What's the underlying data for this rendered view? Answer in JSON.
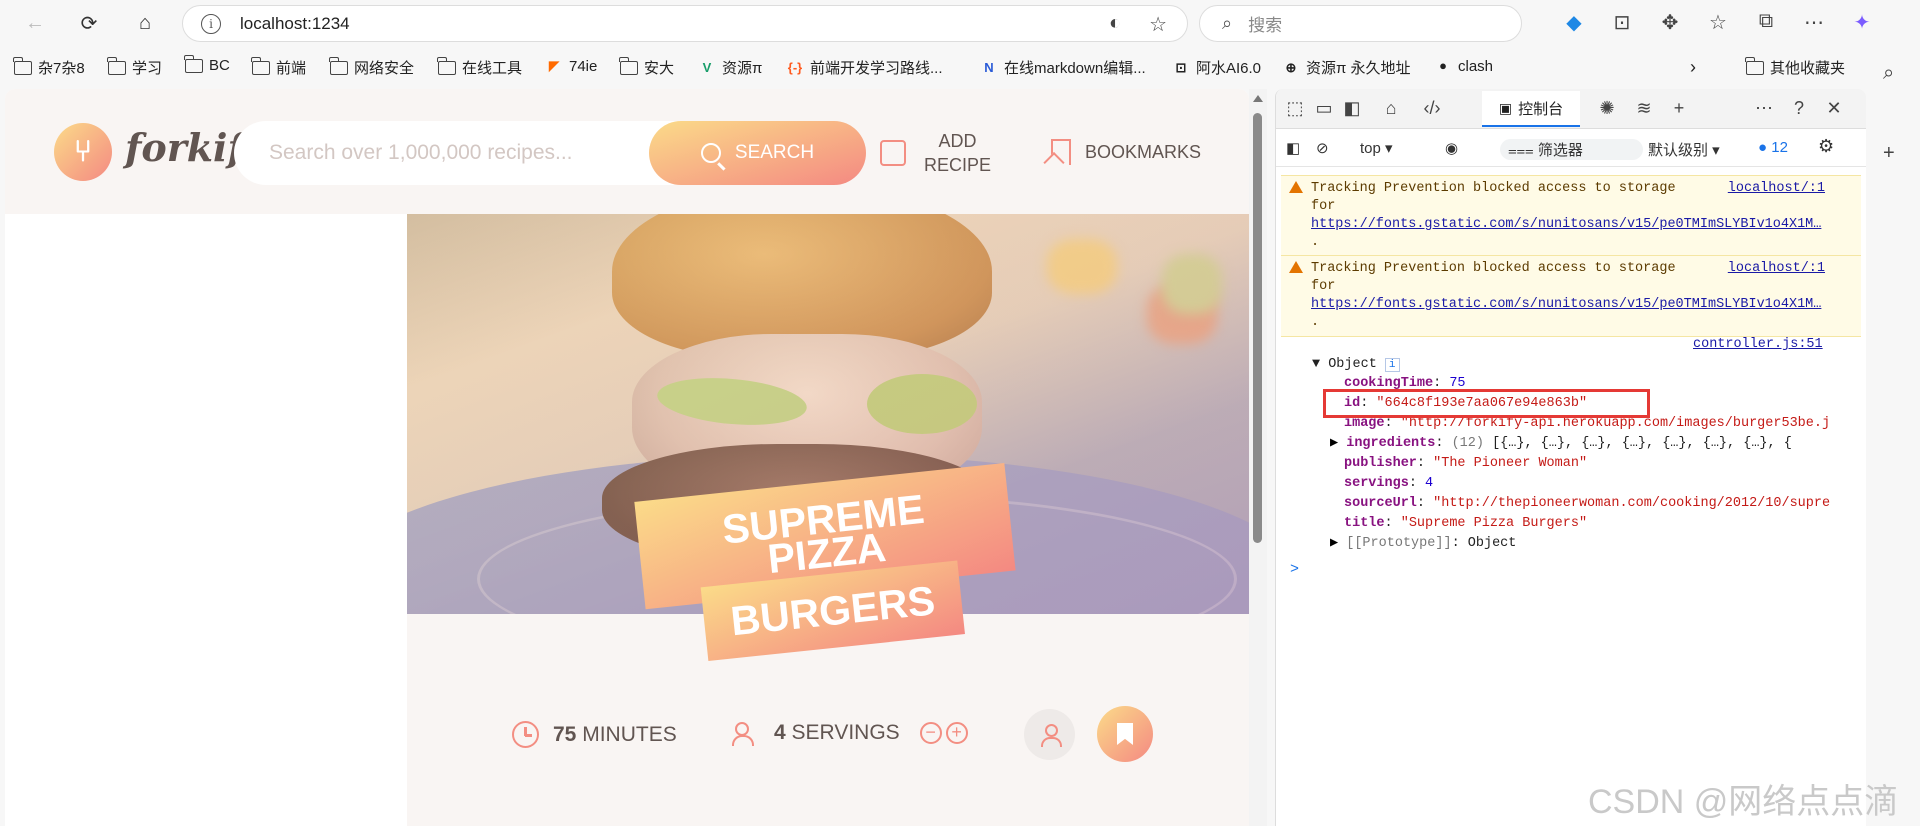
{
  "browser": {
    "url": "localhost:1234",
    "search_placeholder": "搜索",
    "bookmarks": [
      "杂7杂8",
      "学习",
      "BC",
      "前端",
      "网络安全",
      "在线工具",
      "74ie",
      "安大",
      "资源π",
      "前端开发学习路线...",
      "在线markdown编辑...",
      "阿水AI6.0",
      "资源π 永久地址",
      "clash",
      "其他收藏夹"
    ]
  },
  "app": {
    "logo": "forkify",
    "search_placeholder": "Search over 1,000,000 recipes...",
    "search_button": "SEARCH",
    "add_recipe_line1": "ADD",
    "add_recipe_line2": "RECIPE",
    "bookmarks_label": "BOOKMARKS",
    "recipe": {
      "title_line1": "SUPREME PIZZA",
      "title_line2": "BURGERS",
      "minutes_value": "75",
      "minutes_label": "MINUTES",
      "servings_value": "4",
      "servings_label": "SERVINGS"
    }
  },
  "devtools": {
    "console_tab": "控制台",
    "context": "top",
    "filter": "筛选器",
    "level": "默认级别",
    "issue_count": "12",
    "messages": [
      {
        "text": "Tracking Prevention blocked access to storage",
        "for": "for",
        "link": "https://fonts.gstatic.com/s/nunitosans/v15/pe0TMImSLYBIv1o4X1M…",
        "dot": ".",
        "source": "localhost/:1"
      },
      {
        "text": "Tracking Prevention blocked access to storage",
        "for": "for",
        "link": "https://fonts.gstatic.com/s/nunitosans/v15/pe0TMImSLYBIv1o4X1M…",
        "dot": ".",
        "source": "localhost/:1"
      }
    ],
    "log_source": "controller.js:51",
    "object_label": "Object",
    "object_badge": "i",
    "props": {
      "cookingTime_key": "cookingTime",
      "cookingTime_val": "75",
      "id_key": "id",
      "id_val": "\"664c8f193e7aa067e94e863b\"",
      "image_key": "image",
      "image_val": "\"http://forkify-api.herokuapp.com/images/burger53be.j",
      "ingredients_key": "ingredients",
      "ingredients_count": "(12)",
      "ingredients_val": "[{…}, {…}, {…}, {…}, {…}, {…}, {…}, {",
      "publisher_key": "publisher",
      "publisher_val": "\"The Pioneer Woman\"",
      "servings_key": "servings",
      "servings_val": "4",
      "sourceUrl_key": "sourceUrl",
      "sourceUrl_val": "\"http://thepioneerwoman.com/cooking/2012/10/supre",
      "title_key": "title",
      "title_val": "\"Supreme Pizza Burgers\"",
      "prototype_key": "[[Prototype]]",
      "prototype_val": "Object"
    },
    "prompt": ">"
  },
  "watermark": "CSDN @网络点点滴"
}
